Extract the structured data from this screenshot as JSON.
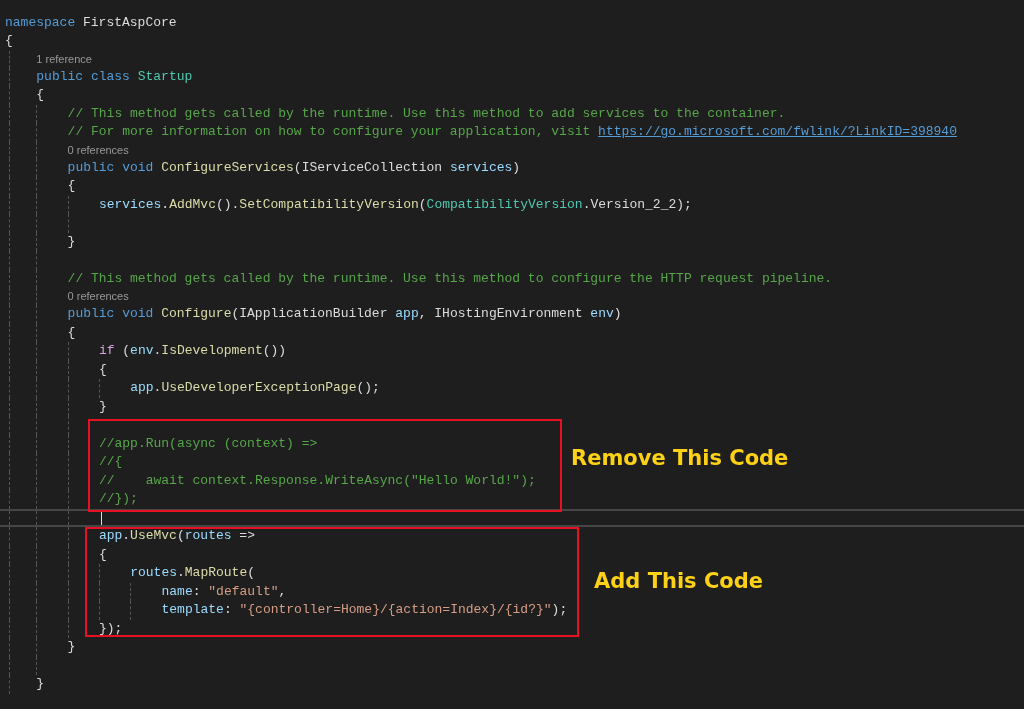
{
  "editor": {
    "lines": [
      {
        "kind": "code",
        "tokens": [
          {
            "text": "namespace ",
            "kind": "kw"
          },
          {
            "text": "FirstAspCore",
            "kind": "plain"
          }
        ]
      },
      {
        "kind": "code",
        "tokens": [
          {
            "text": "{",
            "kind": "plain"
          }
        ],
        "children": [
          {
            "kind": "lens",
            "text": "1 reference"
          },
          {
            "kind": "code",
            "tokens": [
              {
                "text": "public ",
                "kind": "kw"
              },
              {
                "text": "class ",
                "kind": "kw"
              },
              {
                "text": "Startup",
                "kind": "type"
              }
            ]
          },
          {
            "kind": "code",
            "tokens": [
              {
                "text": "{",
                "kind": "plain"
              }
            ],
            "children": [
              {
                "kind": "code",
                "tokens": [
                  {
                    "text": "// This method gets called by the runtime. Use this method to add services to the container.",
                    "kind": "comment"
                  }
                ]
              },
              {
                "kind": "code",
                "tokens": [
                  {
                    "text": "// For more information on how to configure your application, visit ",
                    "kind": "comment"
                  },
                  {
                    "text": "https://go.microsoft.com/fwlink/?LinkID=398940",
                    "kind": "link"
                  }
                ]
              },
              {
                "kind": "lens",
                "text": "0 references"
              },
              {
                "kind": "code",
                "tokens": [
                  {
                    "text": "public ",
                    "kind": "kw"
                  },
                  {
                    "text": "void ",
                    "kind": "kw"
                  },
                  {
                    "text": "ConfigureServices",
                    "kind": "method"
                  },
                  {
                    "text": "(",
                    "kind": "plain"
                  },
                  {
                    "text": "IServiceCollection ",
                    "kind": "iface"
                  },
                  {
                    "text": "services",
                    "kind": "param"
                  },
                  {
                    "text": ")",
                    "kind": "plain"
                  }
                ]
              },
              {
                "kind": "code",
                "tokens": [
                  {
                    "text": "{",
                    "kind": "plain"
                  }
                ],
                "children": [
                  {
                    "kind": "code",
                    "tokens": [
                      {
                        "text": "services",
                        "kind": "param"
                      },
                      {
                        "text": ".",
                        "kind": "plain"
                      },
                      {
                        "text": "AddMvc",
                        "kind": "method"
                      },
                      {
                        "text": "().",
                        "kind": "plain"
                      },
                      {
                        "text": "SetCompatibilityVersion",
                        "kind": "method"
                      },
                      {
                        "text": "(",
                        "kind": "plain"
                      },
                      {
                        "text": "CompatibilityVersion",
                        "kind": "type"
                      },
                      {
                        "text": ".Version_2_2);",
                        "kind": "plain"
                      }
                    ]
                  },
                  {
                    "kind": "blank"
                  }
                ]
              },
              {
                "kind": "code",
                "tokens": [
                  {
                    "text": "}",
                    "kind": "plain"
                  }
                ]
              },
              {
                "kind": "blank"
              },
              {
                "kind": "code",
                "tokens": [
                  {
                    "text": "// This method gets called by the runtime. Use this method to configure the HTTP request pipeline.",
                    "kind": "comment"
                  }
                ]
              },
              {
                "kind": "lens",
                "text": "0 references"
              },
              {
                "kind": "code",
                "tokens": [
                  {
                    "text": "public ",
                    "kind": "kw"
                  },
                  {
                    "text": "void ",
                    "kind": "kw"
                  },
                  {
                    "text": "Configure",
                    "kind": "method"
                  },
                  {
                    "text": "(",
                    "kind": "plain"
                  },
                  {
                    "text": "IApplicationBuilder ",
                    "kind": "iface"
                  },
                  {
                    "text": "app",
                    "kind": "param"
                  },
                  {
                    "text": ", ",
                    "kind": "plain"
                  },
                  {
                    "text": "IHostingEnvironment ",
                    "kind": "iface"
                  },
                  {
                    "text": "env",
                    "kind": "param"
                  },
                  {
                    "text": ")",
                    "kind": "plain"
                  }
                ]
              },
              {
                "kind": "code",
                "tokens": [
                  {
                    "text": "{",
                    "kind": "plain"
                  }
                ],
                "children": [
                  {
                    "kind": "code",
                    "tokens": [
                      {
                        "text": "if",
                        "kind": "ctrl"
                      },
                      {
                        "text": " (",
                        "kind": "plain"
                      },
                      {
                        "text": "env",
                        "kind": "param"
                      },
                      {
                        "text": ".",
                        "kind": "plain"
                      },
                      {
                        "text": "IsDevelopment",
                        "kind": "method"
                      },
                      {
                        "text": "())",
                        "kind": "plain"
                      }
                    ]
                  },
                  {
                    "kind": "code",
                    "tokens": [
                      {
                        "text": "{",
                        "kind": "plain"
                      }
                    ],
                    "children": [
                      {
                        "kind": "code",
                        "tokens": [
                          {
                            "text": "app",
                            "kind": "param"
                          },
                          {
                            "text": ".",
                            "kind": "plain"
                          },
                          {
                            "text": "UseDeveloperExceptionPage",
                            "kind": "method"
                          },
                          {
                            "text": "();",
                            "kind": "plain"
                          }
                        ]
                      }
                    ]
                  },
                  {
                    "kind": "code",
                    "tokens": [
                      {
                        "text": "}",
                        "kind": "plain"
                      }
                    ]
                  },
                  {
                    "kind": "blank"
                  },
                  {
                    "kind": "code",
                    "tokens": [
                      {
                        "text": "//app.Run(async (context) =>",
                        "kind": "comment"
                      }
                    ]
                  },
                  {
                    "kind": "code",
                    "tokens": [
                      {
                        "text": "//{",
                        "kind": "comment"
                      }
                    ]
                  },
                  {
                    "kind": "code",
                    "tokens": [
                      {
                        "text": "//    await context.Response.WriteAsync(\"Hello World!\");",
                        "kind": "comment"
                      }
                    ]
                  },
                  {
                    "kind": "code",
                    "tokens": [
                      {
                        "text": "//});",
                        "kind": "comment"
                      }
                    ]
                  },
                  {
                    "kind": "cursor"
                  },
                  {
                    "kind": "code",
                    "tokens": [
                      {
                        "text": "app",
                        "kind": "param"
                      },
                      {
                        "text": ".",
                        "kind": "plain"
                      },
                      {
                        "text": "UseMvc",
                        "kind": "method"
                      },
                      {
                        "text": "(",
                        "kind": "plain"
                      },
                      {
                        "text": "routes",
                        "kind": "param"
                      },
                      {
                        "text": " =>",
                        "kind": "plain"
                      }
                    ]
                  },
                  {
                    "kind": "code",
                    "tokens": [
                      {
                        "text": "{",
                        "kind": "plain"
                      }
                    ],
                    "children": [
                      {
                        "kind": "code",
                        "tokens": [
                          {
                            "text": "routes",
                            "kind": "param"
                          },
                          {
                            "text": ".",
                            "kind": "plain"
                          },
                          {
                            "text": "MapRoute",
                            "kind": "method"
                          },
                          {
                            "text": "(",
                            "kind": "plain"
                          }
                        ],
                        "children": [
                          {
                            "kind": "code",
                            "tokens": [
                              {
                                "text": "name",
                                "kind": "param"
                              },
                              {
                                "text": ": ",
                                "kind": "plain"
                              },
                              {
                                "text": "\"default\"",
                                "kind": "string"
                              },
                              {
                                "text": ",",
                                "kind": "plain"
                              }
                            ]
                          },
                          {
                            "kind": "code",
                            "tokens": [
                              {
                                "text": "template",
                                "kind": "param"
                              },
                              {
                                "text": ": ",
                                "kind": "plain"
                              },
                              {
                                "text": "\"{controller=Home}/{action=Index}/{id?}\"",
                                "kind": "string"
                              },
                              {
                                "text": ");",
                                "kind": "plain"
                              }
                            ]
                          }
                        ]
                      }
                    ]
                  },
                  {
                    "kind": "code",
                    "tokens": [
                      {
                        "text": "});",
                        "kind": "plain"
                      }
                    ]
                  }
                ]
              },
              {
                "kind": "code",
                "tokens": [
                  {
                    "text": "}",
                    "kind": "plain"
                  }
                ]
              },
              {
                "kind": "blank"
              }
            ]
          },
          {
            "kind": "code",
            "tokens": [
              {
                "text": "}",
                "kind": "plain"
              }
            ]
          }
        ]
      }
    ]
  },
  "annotations": [
    {
      "label": "Remove This Code"
    },
    {
      "label": "Add This Code"
    }
  ]
}
